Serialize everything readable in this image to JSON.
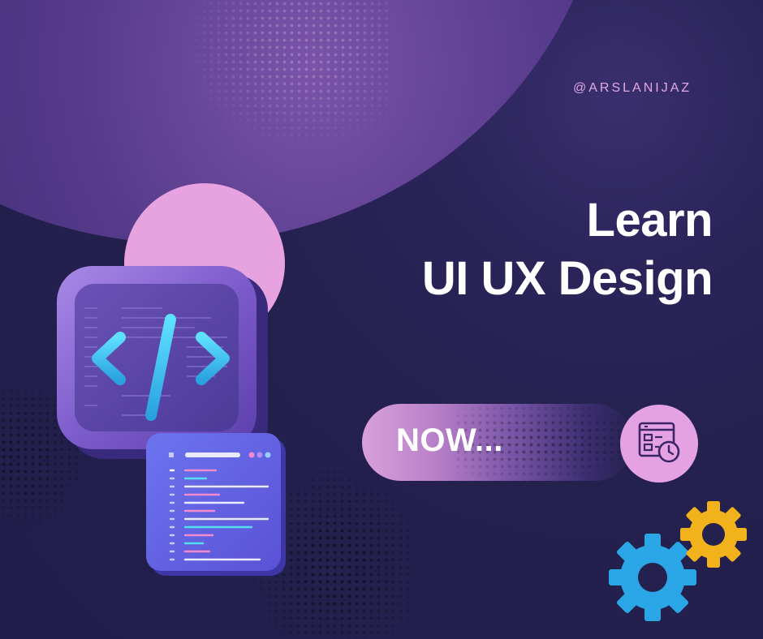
{
  "handle": "@ARSLANIJAZ",
  "headline": {
    "line1": "Learn",
    "line2": "UI UX Design"
  },
  "cta": {
    "label": "NOW..."
  },
  "icons": {
    "tile": "code-brackets-icon",
    "panel": "code-editor-icon",
    "badge": "calendar-clock-icon",
    "gear_large": "gear-icon",
    "gear_small": "gear-icon"
  },
  "colors": {
    "background": "#24214f",
    "accent_pink": "#e4a2e2",
    "gear_blue": "#2aa6e6",
    "gear_yellow": "#f2b21c",
    "bracket_cyan": "#33c6ee"
  }
}
